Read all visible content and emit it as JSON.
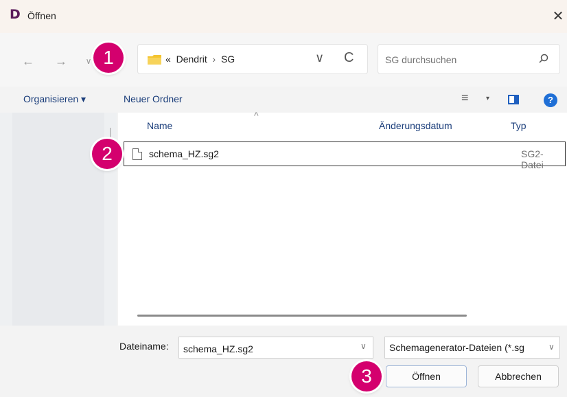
{
  "window": {
    "logo": "D",
    "title": "Öffnen",
    "close": "✕"
  },
  "nav": {
    "back": "←",
    "forward": "→",
    "recent": "∨"
  },
  "address": {
    "folder_icon": "folder-icon",
    "prefix": "«",
    "parts": [
      "Dendrit",
      "SG"
    ],
    "separator": "›",
    "dropdown": "∨",
    "refresh": "C"
  },
  "search": {
    "placeholder": "SG durchsuchen",
    "icon": "search-icon"
  },
  "toolbar": {
    "organize": "Organisieren ▾",
    "new_folder": "Neuer Ordner",
    "view_icon": "≡",
    "view_caret": "▾",
    "help": "?"
  },
  "columns": {
    "sort_indicator": "^",
    "name": "Name",
    "date": "Änderungsdatum",
    "type": "Typ"
  },
  "files": [
    {
      "name": "schema_HZ.sg2",
      "type": "SG2-Datei"
    }
  ],
  "footer": {
    "filename_label": "Dateiname:",
    "filename_value": "schema_HZ.sg2",
    "filetype": "Schemagenerator-Dateien (*.sg",
    "open": "Öffnen",
    "cancel": "Abbrechen"
  },
  "markers": [
    "1",
    "2",
    "3"
  ],
  "colors": {
    "marker": "#d4006e",
    "link": "#1a3d7a",
    "accent": "#1f6fd6"
  }
}
